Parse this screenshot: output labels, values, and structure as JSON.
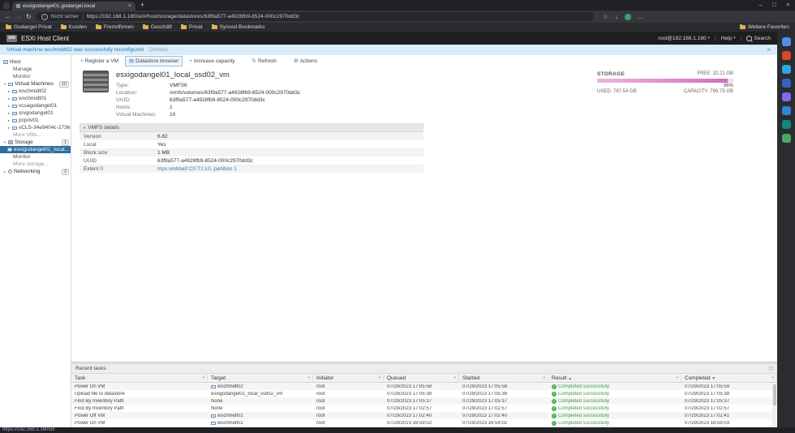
{
  "browser": {
    "tab": {
      "title": "esxigodangel01.godangel.local"
    },
    "nav": {
      "security_label": "Nicht sicher",
      "url": "https://192.168.1.180/ui/#/host/storage/datastores/63f9a577-a4928fb9-8524-000c2970dd3c"
    },
    "bookmarks": [
      {
        "label": "Godangel Privat"
      },
      {
        "label": "Kunden"
      },
      {
        "label": "Fremdfirmen"
      },
      {
        "label": "Geschäft"
      },
      {
        "label": "Privat"
      },
      {
        "label": "Synced Bookmarks"
      }
    ],
    "bookmarks_more": "Weitere Favoriten",
    "status_url": "https://192.168.1.180/ui/",
    "sidebar_apps": [
      {
        "color": "#4f8fe8"
      },
      {
        "color": "#d6492f"
      },
      {
        "color": "#2da7e0"
      },
      {
        "color": "#3a5fc4"
      },
      {
        "color": "#7b6cf0"
      },
      {
        "color": "#2f86d4"
      },
      {
        "color": "#13857b"
      },
      {
        "color": "#48a860"
      }
    ]
  },
  "esxi": {
    "header": {
      "logo": "vm",
      "title": "ESXi Host Client",
      "user": "root@192.168.1.180",
      "help": "Help",
      "search": "Search"
    },
    "banner": {
      "text": "Virtual machine wschmidt02 was successfully reconfigured",
      "action": "Dismiss"
    },
    "navigator": {
      "host": {
        "label": "Host",
        "children": [
          {
            "label": "Manage"
          },
          {
            "label": "Monitor"
          }
        ]
      },
      "vms": {
        "label": "Virtual Machines",
        "count": "10",
        "items": [
          {
            "label": "wschmidt02"
          },
          {
            "label": "wschmidt01"
          },
          {
            "label": "vcsagodangel01"
          },
          {
            "label": "srvgodangel01"
          },
          {
            "label": "pcpnv01"
          },
          {
            "label": "vCLS-34e9404c-2736-..."
          }
        ],
        "more": "More VMs..."
      },
      "storage": {
        "label": "Storage",
        "count": "1",
        "selected_item": "esxigodangel01_local...",
        "children": [
          {
            "label": "Monitor"
          }
        ],
        "more": "More storage..."
      },
      "networking": {
        "label": "Networking",
        "count": "2"
      }
    },
    "toolbar": [
      {
        "label": "Register a VM",
        "icon": "add-vm-icon",
        "glyph": "+"
      },
      {
        "label": "Datastore browser",
        "icon": "datastore-browser-icon",
        "glyph": "▤",
        "active": true
      },
      {
        "label": "Increase capacity",
        "icon": "increase-capacity-icon",
        "glyph": "+"
      },
      {
        "label": "Refresh",
        "icon": "refresh-icon",
        "glyph": "↻",
        "gap": true
      },
      {
        "label": "Actions",
        "icon": "gear-icon",
        "glyph": "⚙",
        "gap": true
      }
    ],
    "datastore": {
      "name": "esxigodangel01_local_ssd02_vm",
      "fields": [
        {
          "label": "Type:",
          "value": "VMFS6"
        },
        {
          "label": "Location:",
          "value": "/vmfs/volumes/63f9a577-a4928fb9-8524-000c2970dd3c"
        },
        {
          "label": "UUID:",
          "value": "63f9a577-a4928fb9-8524-000c2970dd3c"
        },
        {
          "label": "Hosts:",
          "value": "1"
        },
        {
          "label": "Virtual Machines:",
          "value": "10"
        }
      ]
    },
    "storage_meter": {
      "title": "STORAGE",
      "free": "FREE: 32.21 GB",
      "percent": "96%",
      "used": "USED: 767.54 GB",
      "capacity": "CAPACITY: 799.75 GB",
      "used_pct": 96,
      "bar_color": "#cf6fba"
    },
    "vmfs": {
      "title": "VMFS details",
      "rows": [
        {
          "label": "Version",
          "value": "6.82"
        },
        {
          "label": "Local",
          "value": "Yes"
        },
        {
          "label": "Block size",
          "value": "1 MB"
        },
        {
          "label": "UUID",
          "value": "63f9a577-a4928fb9-8524-000c2970dd3c"
        },
        {
          "label": "Extent 0",
          "value": "mpx.vmhba0:C0:T1:L0, partition 1",
          "link": true
        }
      ]
    },
    "tasks": {
      "title": "Recent tasks",
      "columns": [
        {
          "label": "Task"
        },
        {
          "label": "Target"
        },
        {
          "label": "Initiator"
        },
        {
          "label": "Queued"
        },
        {
          "label": "Started"
        },
        {
          "label": "Result",
          "sort": "▲"
        },
        {
          "label": "Completed",
          "sort": "▼"
        }
      ],
      "rows": [
        {
          "task": "Power On VM",
          "target": "wschmidt02",
          "vm": true,
          "initiator": "root",
          "queued": "07/29/2023 17:05:58",
          "started": "07/29/2023 17:05:58",
          "result": "Completed successfully",
          "completed": "07/29/2023 17:05:59"
        },
        {
          "task": "Upload file to datastore",
          "target": "esxigodangel01_local_ssd02_vm",
          "initiator": "root",
          "queued": "07/29/2023 17:05:38",
          "started": "07/29/2023 17:05:38",
          "result": "Completed successfully",
          "completed": "07/29/2023 17:05:38"
        },
        {
          "task": "Find By Inventory Path",
          "target": "None",
          "initiator": "root",
          "queued": "07/29/2023 17:05:37",
          "started": "07/29/2023 17:05:37",
          "result": "Completed successfully",
          "completed": "07/29/2023 17:05:37"
        },
        {
          "task": "Find By Inventory Path",
          "target": "None",
          "initiator": "root",
          "queued": "07/29/2023 17:02:57",
          "started": "07/29/2023 17:02:57",
          "result": "Completed successfully",
          "completed": "07/29/2023 17:02:57"
        },
        {
          "task": "Power Off VM",
          "target": "wschmidt02",
          "vm": true,
          "initiator": "root",
          "queued": "07/29/2023 17:02:40",
          "started": "07/29/2023 17:02:40",
          "result": "Completed successfully",
          "completed": "07/29/2023 17:02:41"
        },
        {
          "task": "Power On VM",
          "target": "wschmidt02",
          "vm": true,
          "initiator": "root",
          "queued": "07/29/2023 16:59:02",
          "started": "07/29/2023 16:59:02",
          "result": "Completed successfully",
          "completed": "07/29/2023 16:59:03"
        }
      ]
    }
  }
}
